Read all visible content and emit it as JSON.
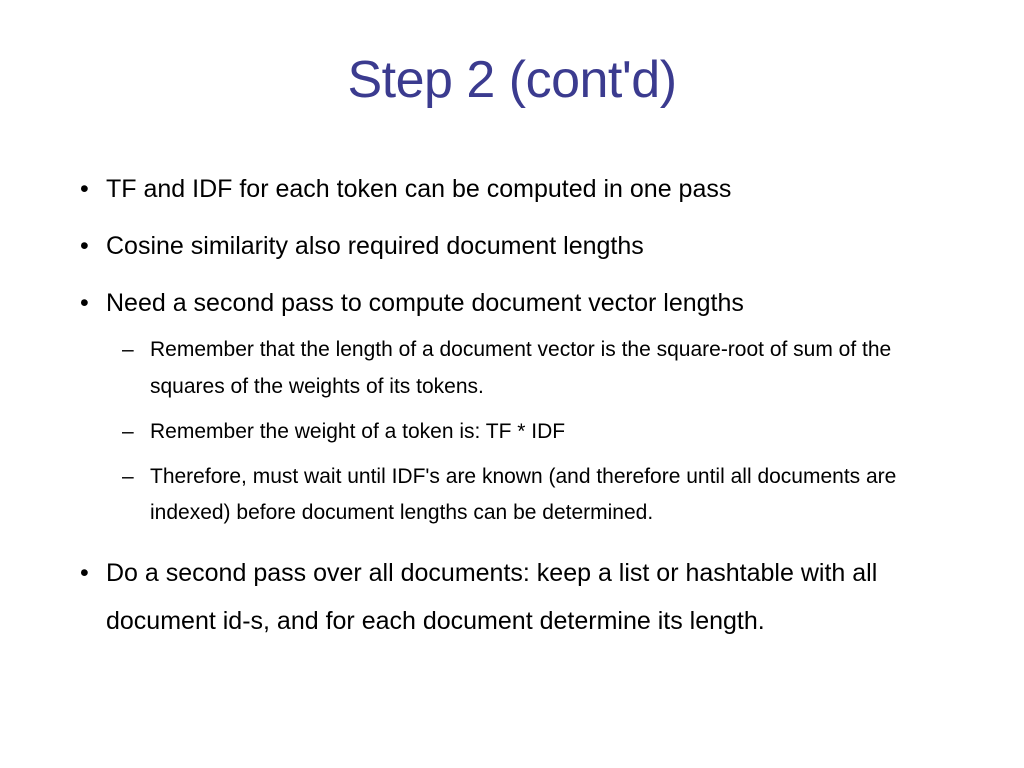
{
  "slide": {
    "title": "Step 2 (cont'd)",
    "bullets": [
      {
        "text": "TF and IDF for each token can be computed in one pass"
      },
      {
        "text": "Cosine similarity also required document lengths"
      },
      {
        "text": "Need a second pass to compute document vector lengths",
        "subs": [
          "Remember that the length of a document vector is the square-root of sum of the squares of the weights of its tokens.",
          "Remember the weight of a token is: TF * IDF",
          "Therefore, must wait until IDF's are known (and therefore until all documents are indexed) before document lengths can be determined."
        ]
      },
      {
        "text": "Do a second pass over all documents: keep a list or hashtable with all document id-s, and for each document determine its length."
      }
    ]
  }
}
